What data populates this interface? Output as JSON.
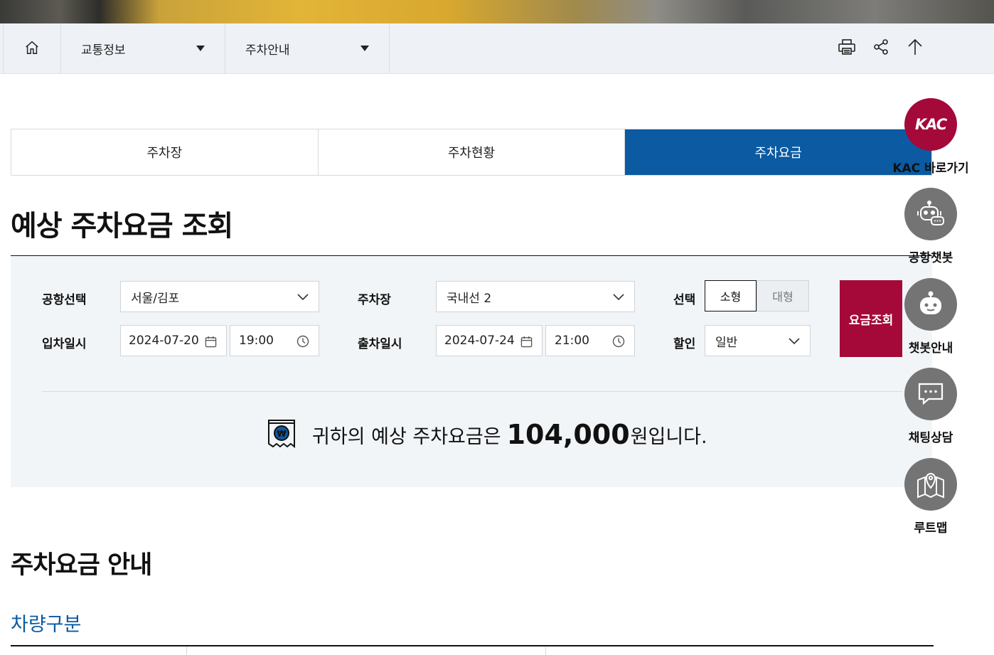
{
  "location": {
    "home_icon": "home-icon",
    "dropdowns": [
      {
        "label": "교통정보"
      },
      {
        "label": "주차안내"
      }
    ],
    "tools": [
      "print-icon",
      "share-icon",
      "arrow-up-icon"
    ]
  },
  "tabs": [
    {
      "label": "주차장",
      "active": false
    },
    {
      "label": "주차현황",
      "active": false
    },
    {
      "label": "주차요금",
      "active": true
    }
  ],
  "title": "예상 주차요금 조회",
  "form": {
    "airport_label": "공항선택",
    "airport_value": "서울/김포",
    "lot_label": "주차장",
    "lot_value": "국내선 2",
    "select_label": "선택",
    "size_small": "소형",
    "size_large": "대형",
    "entry_label": "입차일시",
    "entry_date": "2024-07-20",
    "entry_time": "19:00",
    "exit_label": "출차일시",
    "exit_date": "2024-07-24",
    "exit_time": "21:00",
    "discount_label": "할인",
    "discount_value": "일반",
    "search_button": "요금조회"
  },
  "result": {
    "prefix": "귀하의 예상 주차요금은",
    "amount": "104,000",
    "suffix": "원입니다."
  },
  "guide_title": "주차요금 안내",
  "vehicle_section": "차량구분",
  "quick_menu": [
    {
      "label": "KAC 바로가기",
      "icon": "kac-logo-icon",
      "logo": "KAC"
    },
    {
      "label": "공항챗봇",
      "icon": "airport-chatbot-icon"
    },
    {
      "label": "챗봇안내",
      "icon": "robot-icon"
    },
    {
      "label": "채팅상담",
      "icon": "chat-bubble-icon"
    },
    {
      "label": "루트맵",
      "icon": "route-map-icon"
    }
  ],
  "colors": {
    "primary_blue": "#0b5aa2",
    "accent_red": "#a4093a",
    "panel_bg": "#f2f5f8"
  }
}
